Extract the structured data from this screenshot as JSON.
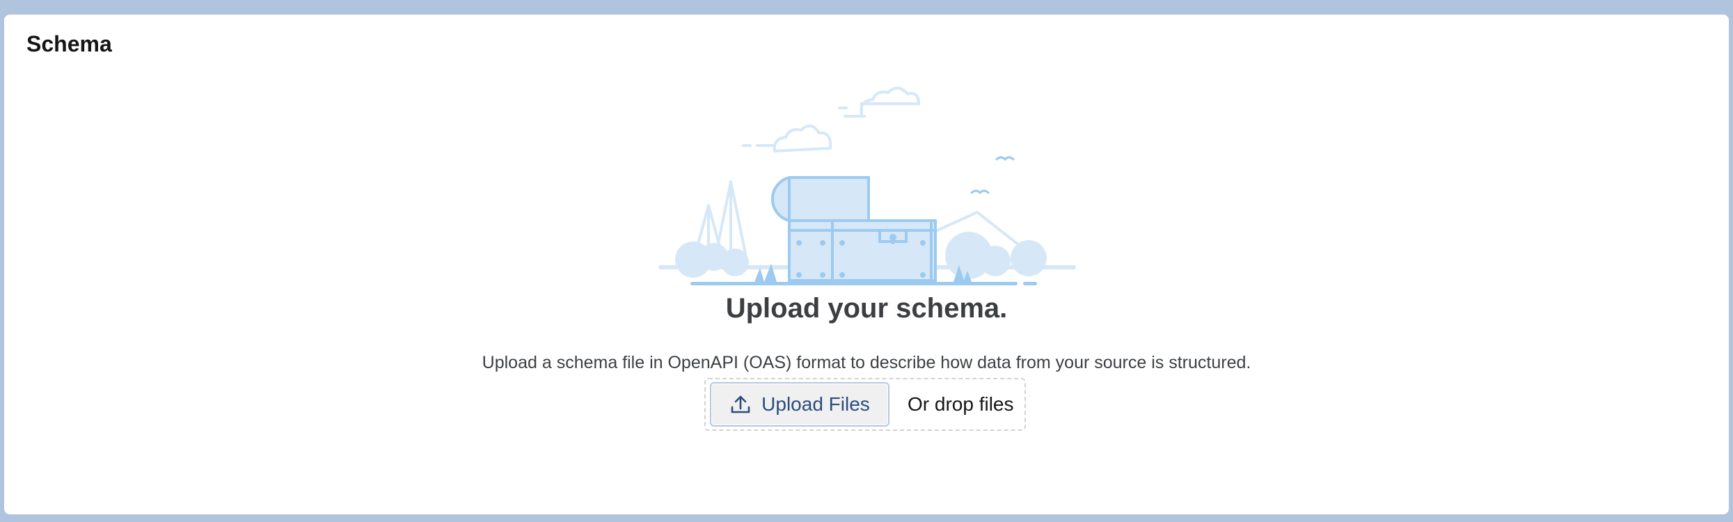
{
  "panel": {
    "title": "Schema"
  },
  "empty_state": {
    "illustration": "treasure-chest-illustration",
    "title": "Upload your schema.",
    "body": "Upload a schema file in OpenAPI (OAS) format to describe how data from your source is structured."
  },
  "uploader": {
    "button_label": "Upload Files",
    "button_icon": "upload-icon",
    "drop_text": "Or drop files"
  },
  "colors": {
    "background": "#b0c4de",
    "button_text": "#2b4c7e",
    "illustration_light": "#d6e8f8",
    "illustration_stroke": "#9ccaf0"
  }
}
